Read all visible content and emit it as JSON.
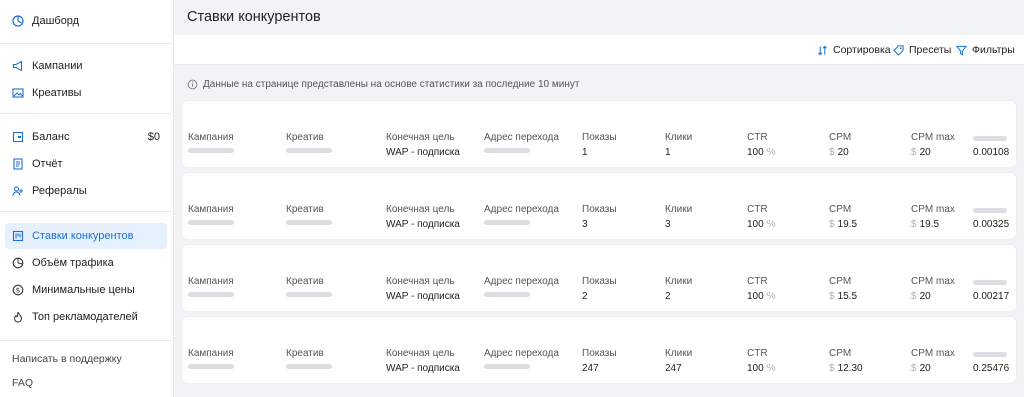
{
  "sidebar": {
    "items": [
      {
        "label": "Дашборд",
        "icon": "dashboard-icon"
      },
      {
        "label": "Кампании",
        "icon": "megaphone-icon"
      },
      {
        "label": "Креативы",
        "icon": "image-icon"
      },
      {
        "label": "Баланс",
        "icon": "wallet-icon",
        "value": "$0"
      },
      {
        "label": "Отчёт",
        "icon": "report-icon"
      },
      {
        "label": "Рефералы",
        "icon": "referrals-icon"
      },
      {
        "label": "Ставки конкурентов",
        "icon": "bids-icon",
        "active": true
      },
      {
        "label": "Объём трафика",
        "icon": "pie-icon"
      },
      {
        "label": "Минимальные цены",
        "icon": "dollar-icon"
      },
      {
        "label": "Топ рекламодателей",
        "icon": "fire-icon"
      }
    ],
    "support": "Написать в поддержку",
    "faq": "FAQ"
  },
  "page": {
    "title": "Ставки конкурентов",
    "info": "Данные на странице представлены на основе статистики за последние 10 минут"
  },
  "toolbar": {
    "sort": "Сортировка",
    "presets": "Пресеты",
    "filters": "Фильтры"
  },
  "columns": {
    "campaign": "Кампания",
    "creative": "Креатив",
    "goal": "Конечная цель",
    "url": "Адрес перехода",
    "impressions": "Показы",
    "clicks": "Клики",
    "ctr": "CTR",
    "cpm": "CPM",
    "cpm_max": "CPM max"
  },
  "currency": "$",
  "percent": "%",
  "rows": [
    {
      "goal": "WAP - подписка",
      "impressions": "1",
      "clicks": "1",
      "ctr": "100",
      "cpm": "20",
      "cpm_max": "20",
      "value": "0.00108"
    },
    {
      "goal": "WAP - подписка",
      "impressions": "3",
      "clicks": "3",
      "ctr": "100",
      "cpm": "19.5",
      "cpm_max": "19.5",
      "value": "0.00325"
    },
    {
      "goal": "WAP - подписка",
      "impressions": "2",
      "clicks": "2",
      "ctr": "100",
      "cpm": "15.5",
      "cpm_max": "20",
      "value": "0.00217"
    },
    {
      "goal": "WAP - подписка",
      "impressions": "247",
      "clicks": "247",
      "ctr": "100",
      "cpm": "12.30",
      "cpm_max": "20",
      "value": "0.25476"
    }
  ],
  "colors": {
    "accent": "#1b6fd6",
    "active_bg": "#e6f1fd",
    "muted": "#aab0b8"
  }
}
